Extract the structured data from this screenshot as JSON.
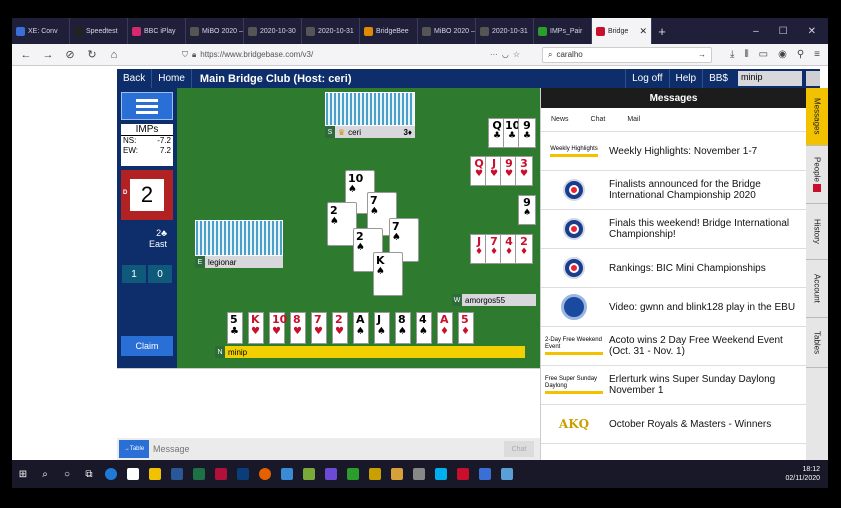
{
  "browser": {
    "tabs": [
      {
        "label": "XE: Conv",
        "color": "#3a6fd6"
      },
      {
        "label": "Speedtest",
        "color": "#222"
      },
      {
        "label": "BBC iPlay",
        "color": "#d62a6f"
      },
      {
        "label": "MiBO 2020 –",
        "color": "#555"
      },
      {
        "label": "2020-10-30",
        "color": "#555"
      },
      {
        "label": "2020-10-31",
        "color": "#555"
      },
      {
        "label": "BridgeBee",
        "color": "#e08a00"
      },
      {
        "label": "MiBO 2020 –",
        "color": "#555"
      },
      {
        "label": "2020-10-31",
        "color": "#555"
      },
      {
        "label": "IMPs_Pair",
        "color": "#2a9d2a"
      },
      {
        "label": "Bridge",
        "color": "#c8102e"
      }
    ],
    "url": "https://www.bridgebase.com/v3/",
    "search": "caralho"
  },
  "header": {
    "back": "Back",
    "home": "Home",
    "title": "Main Bridge Club (Host: ceri)",
    "logoff": "Log off",
    "help": "Help",
    "bbs": "BB$",
    "username": "minip"
  },
  "left": {
    "imps_title": "IMPs",
    "ns_label": "NS:",
    "ns_value": "-7.2",
    "ew_label": "EW:",
    "ew_value": "7.2",
    "dealer_letter": "D",
    "board_number": "2",
    "contract": "2♣",
    "declarer": "East",
    "tricks_ns": "1",
    "tricks_ew": "0",
    "claim": "Claim"
  },
  "table": {
    "north": {
      "seat": "S",
      "name": "ceri",
      "bid": "3♦"
    },
    "west": {
      "seat": "E",
      "name": "legionar"
    },
    "east": {
      "seat": "W",
      "name": "amorgos55"
    },
    "south": {
      "seat": "N",
      "name": "minip"
    },
    "played": [
      {
        "rank": "10",
        "suit": "♠",
        "color": "blk"
      },
      {
        "rank": "2",
        "suit": "♠",
        "color": "blk"
      },
      {
        "rank": "7",
        "suit": "♠",
        "color": "blk"
      },
      {
        "rank": "7",
        "suit": "♠",
        "color": "blk"
      },
      {
        "rank": "2",
        "suit": "♠",
        "color": "blk"
      },
      {
        "rank": "K",
        "suit": "♠",
        "color": "blk"
      }
    ],
    "east_hand": [
      {
        "rank": "Q",
        "suit": "♣",
        "color": "blk"
      },
      {
        "rank": "10",
        "suit": "♣",
        "color": "blk"
      },
      {
        "rank": "9",
        "suit": "♣",
        "color": "blk"
      },
      {
        "rank": "Q",
        "suit": "♥",
        "color": "red"
      },
      {
        "rank": "J",
        "suit": "♥",
        "color": "red"
      },
      {
        "rank": "9",
        "suit": "♥",
        "color": "red"
      },
      {
        "rank": "3",
        "suit": "♥",
        "color": "red"
      },
      {
        "rank": "9",
        "suit": "♠",
        "color": "blk"
      },
      {
        "rank": "J",
        "suit": "♦",
        "color": "red"
      },
      {
        "rank": "7",
        "suit": "♦",
        "color": "red"
      },
      {
        "rank": "4",
        "suit": "♦",
        "color": "red"
      },
      {
        "rank": "2",
        "suit": "♦",
        "color": "red"
      }
    ],
    "south_hand": [
      {
        "rank": "5",
        "suit": "♣",
        "color": "blk"
      },
      {
        "rank": "K",
        "suit": "♥",
        "color": "red"
      },
      {
        "rank": "10",
        "suit": "♥",
        "color": "red"
      },
      {
        "rank": "8",
        "suit": "♥",
        "color": "red"
      },
      {
        "rank": "7",
        "suit": "♥",
        "color": "red"
      },
      {
        "rank": "2",
        "suit": "♥",
        "color": "red"
      },
      {
        "rank": "A",
        "suit": "♠",
        "color": "blk"
      },
      {
        "rank": "J",
        "suit": "♠",
        "color": "blk"
      },
      {
        "rank": "8",
        "suit": "♠",
        "color": "blk"
      },
      {
        "rank": "4",
        "suit": "♠",
        "color": "blk"
      },
      {
        "rank": "A",
        "suit": "♦",
        "color": "red"
      },
      {
        "rank": "5",
        "suit": "♦",
        "color": "red"
      }
    ]
  },
  "chat": {
    "table_btn": "→Table",
    "placeholder": "Message",
    "chat_btn": "Chat"
  },
  "messages": {
    "title": "Messages",
    "tabs": [
      "News",
      "Chat",
      "Mail"
    ],
    "items": [
      {
        "thumb": "label",
        "thumb_text": "Weekly Highlights",
        "text": "Weekly Highlights: November 1-7"
      },
      {
        "thumb": "logo",
        "text": "Finalists announced for the Bridge International Championship 2020"
      },
      {
        "thumb": "logo",
        "text": "Finals this weekend! Bridge International Championship!"
      },
      {
        "thumb": "logo",
        "text": "Rankings: BIC Mini Championships"
      },
      {
        "thumb": "circle",
        "text": "Video: gwnn and blink128 play in the EBU"
      },
      {
        "thumb": "label",
        "thumb_text": "2-Day Free Weekend Event",
        "text": "Acoto wins 2 Day Free Weekend Event (Oct. 31 - Nov. 1)"
      },
      {
        "thumb": "label",
        "thumb_text": "Free Super Sunday Daylong",
        "text": "Erlerturk wins Super Sunday Daylong November 1"
      },
      {
        "thumb": "akq",
        "thumb_text": "AKQ",
        "text": "October Royals & Masters - Winners"
      }
    ]
  },
  "sidetabs": [
    "Messages",
    "People",
    "History",
    "Account",
    "Tables"
  ],
  "taskbar": {
    "time": "18:12",
    "date": "02/11/2020"
  }
}
